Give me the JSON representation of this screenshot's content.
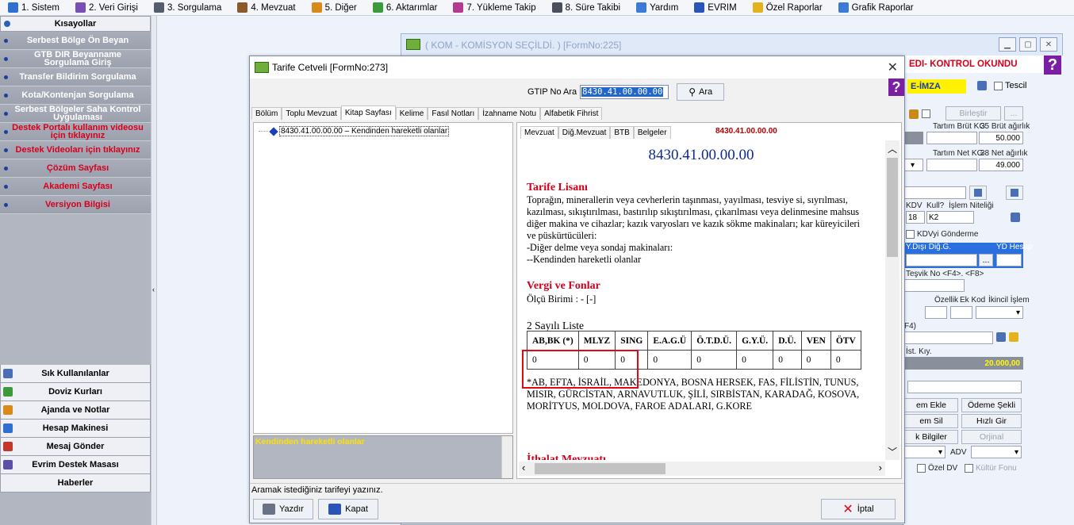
{
  "menu": [
    {
      "label": "1. Sistem",
      "icon": "gear-icon",
      "color": "#2f6fcf"
    },
    {
      "label": "2. Veri Girişi",
      "icon": "pencil-icon",
      "color": "#7a4fb5"
    },
    {
      "label": "3. Sorgulama",
      "icon": "query-icon",
      "color": "#555c6b"
    },
    {
      "label": "4. Mevzuat",
      "icon": "books-icon",
      "color": "#8b5a2b"
    },
    {
      "label": "5. Diğer",
      "icon": "tools-icon",
      "color": "#d98b1a"
    },
    {
      "label": "6. Aktarımlar",
      "icon": "transfer-icon",
      "color": "#3c9a3c"
    },
    {
      "label": "7. Yükleme Takip",
      "icon": "truck-icon",
      "color": "#b33a8f"
    },
    {
      "label": "8. Süre Takibi",
      "icon": "calendar-icon",
      "color": "#4a4f5c"
    },
    {
      "label": "Yardım",
      "icon": "help-icon",
      "color": "#3a7bd5"
    },
    {
      "label": "EVRIM",
      "icon": "evrim-icon",
      "color": "#2a55b8"
    },
    {
      "label": "Özel Raporlar",
      "icon": "star-icon",
      "color": "#e3b21c"
    },
    {
      "label": "Grafik Raporlar",
      "icon": "chart-icon",
      "color": "#3a7bd5"
    }
  ],
  "sidebar": {
    "title": "Kısayollar",
    "items": [
      {
        "label": "Serbest Bölge Ön Beyan",
        "red": false
      },
      {
        "label": "GTB DIR Beyanname Sorgulama Giriş",
        "red": false
      },
      {
        "label": "Transfer Bildirim Sorgulama",
        "red": false
      },
      {
        "label": "Kota/Kontenjan Sorgulama",
        "red": false
      },
      {
        "label": "Serbest Bölgeler Saha Kontrol Uygulaması",
        "red": false
      },
      {
        "label": "Destek Portalı kullanım videosu için tıklayınız",
        "red": true
      },
      {
        "label": "Destek Videoları için tıklayınız",
        "red": true
      },
      {
        "label": "Çözüm Sayfası",
        "red": true
      },
      {
        "label": "Akademi Sayfası",
        "red": true
      },
      {
        "label": "Versiyon Bilgisi",
        "red": true
      }
    ],
    "bottom": [
      {
        "label": "Sık Kullanılanlar",
        "icon": "favorites-icon",
        "color": "#4a6fb5"
      },
      {
        "label": "Doviz Kurları",
        "icon": "currency-icon",
        "color": "#3c9a3c"
      },
      {
        "label": "Ajanda ve Notlar",
        "icon": "notebook-icon",
        "color": "#d98b1a"
      },
      {
        "label": "Hesap Makinesi",
        "icon": "calculator-icon",
        "color": "#2f6fcf"
      },
      {
        "label": "Mesaj Gönder",
        "icon": "message-icon",
        "color": "#c0392b"
      },
      {
        "label": "Evrim Destek Masası",
        "icon": "support-icon",
        "color": "#5a4fa5"
      },
      {
        "label": "Haberler",
        "icon": "",
        "color": ""
      }
    ]
  },
  "bg_window": {
    "title": "( KOM - KOMİSYON SEÇİLDİ. ) [FormNo:225]",
    "edi_status": "EDI- KONTROL OKUNDU",
    "eimza": "E-İMZA",
    "tescil": "Tescil",
    "birlestir": "Birleştir",
    "tartim_brut": "Tartım Brüt KG",
    "brut_agirlik": "35 Brüt ağırlık",
    "brut_value": "50.000",
    "tartim_net": "Tartım Net KG",
    "net_agirlik": "38 Net ağırlık",
    "net_value": "49.000",
    "kdv": "KDV",
    "kull": "Kull?",
    "islem_niteligi": "İşlem Niteliği",
    "kdv_value": "18",
    "k2_value": "K2",
    "kdvyi_gonderme": "KDVyi Gönderme",
    "ydisi": "Y.Dışı Diğ.G.",
    "yd_hesap": "YD Hesap",
    "tesvik": "Teşvik No <F4>. <F8>",
    "ozellik": "Özellik",
    "ek_kod": "Ek Kod",
    "ikincil": "İkincil İşlem",
    "f4": "F4)",
    "ist_kiy": "İst. Kıy.",
    "ist_value": "20.000,00",
    "em_ekle": "em Ekle",
    "odeme_sekli": "Ödeme Şekli",
    "em_sil": "em Sil",
    "hizli_gir": "Hızlı Gir",
    "k_bilgiler": "k Bilgiler",
    "orjinal": "Orjinal",
    "adv": "ADV",
    "ozel_dv": "Özel DV",
    "kultur_fonu": "Kültür Fonu"
  },
  "tarife": {
    "title": "Tarife Cetveli [FormNo:273]",
    "gtip_label": "GTIP No Ara",
    "gtip_value": "8430.41.00.00.00",
    "ara_button": "Ara",
    "tabs": [
      "Bölüm",
      "Toplu Mevzuat",
      "Kitap Sayfası",
      "Kelime",
      "Fasıl Notları",
      "İzahname Notu",
      "Alfabetik Fihrist"
    ],
    "tree_item": "8430.41.00.00.00 – Kendinden hareketli olanlar",
    "description": "Kendinden hareketli olanlar",
    "right_tabs": [
      "Mevzuat",
      "Diğ.Mevzuat",
      "BTB",
      "Belgeler"
    ],
    "right_code": "8430.41.00.00.00",
    "doc": {
      "code": "8430.41.00.00.00",
      "lisan_title": "Tarife Lisanı",
      "lisan_lines": [
        "Toprağın, minerallerin veya cevherlerin taşınması, yayılması, tesviye si, sıyrılması,",
        "kazılması, sıkıştırılması, bastırılıp sıkıştırılması, çıkarılması veya delinmesine mahsus",
        "diğer makina ve cihazlar; kazık varyosları ve kazık sökme makinaları; kar küreyicileri",
        "ve püskürtücüleri:",
        "-Diğer delme veya sondaj makinaları:",
        "--Kendinden hareketli olanlar"
      ],
      "vergi_title": "Vergi ve Fonlar",
      "olcu": "Ölçü Birimi : - [-]",
      "liste_title": "2 Sayılı Liste",
      "table_headers": [
        "AB,BK (*)",
        "MLYZ",
        "SING",
        "E.A.G.Ü",
        "Ö.T.D.Ü.",
        "G.Y.Ü.",
        "D.Ü.",
        "VEN",
        "ÖTV"
      ],
      "table_values": [
        "0",
        "0",
        "0",
        "0",
        "0",
        "0",
        "0",
        "0",
        "0"
      ],
      "footnote_lines": [
        "*AB, EFTA, İSRAİL, MAKEDONYA, BOSNA HERSEK, FAS, FİLİSTİN, TUNUS,",
        "MISIR, GÜRCİSTAN, ARNAVUTLUK, ŞİLİ, SIRBİSTAN, KARADAĞ, KOSOVA,",
        "MORİTYUS, MOLDOVA, FAROE ADALARI, G.KORE"
      ],
      "ithalat_title": "İthalat Mevzuatı"
    },
    "status": "Aramak istediğiniz tarifeyi yazınız.",
    "yazdir": "Yazdır",
    "kapat": "Kapat",
    "iptal": "İptal"
  }
}
